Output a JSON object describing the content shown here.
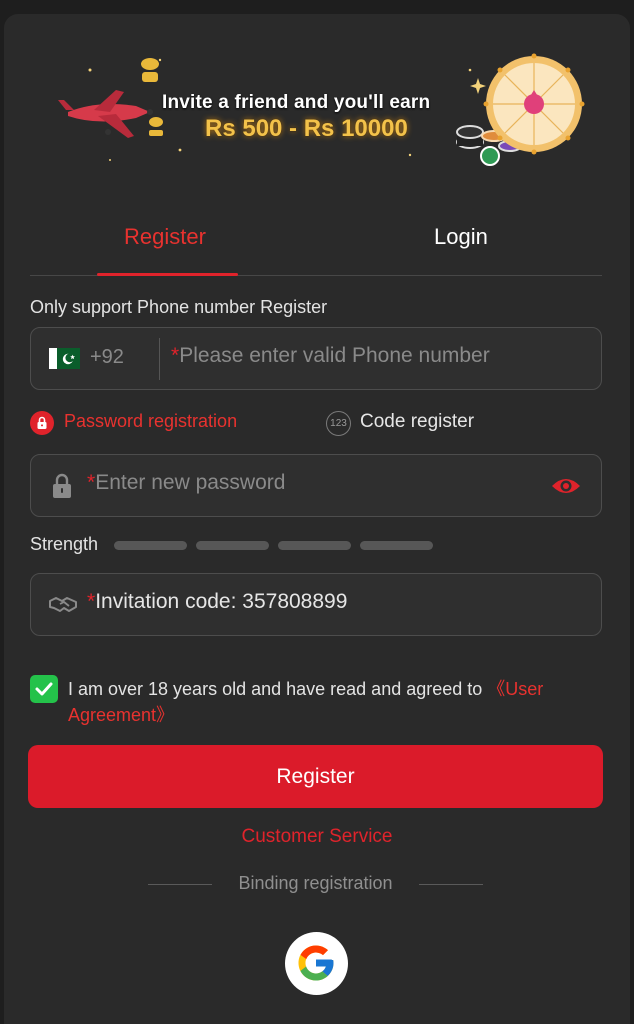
{
  "banner": {
    "title": "Invite a friend and you'll earn",
    "amount": "Rs 500 - Rs 10000"
  },
  "tabs": [
    {
      "label": "Register",
      "active": true
    },
    {
      "label": "Login",
      "active": false
    }
  ],
  "register_form": {
    "phone_label": "Only support Phone number Register",
    "country_code": "+92",
    "country_flag": "pakistan-flag-icon",
    "phone_placeholder": "Please enter valid Phone number",
    "required_mark": "*",
    "methods": [
      {
        "label": "Password registration",
        "icon": "lock-icon",
        "selected": true
      },
      {
        "label": "Code register",
        "icon": "123-icon",
        "icon_text": "123",
        "selected": false
      }
    ],
    "password_placeholder": "Enter new password",
    "strength_label": "Strength",
    "strength_level": 0,
    "strength_segments": 4,
    "invite_value": "Invitation code: 357808899",
    "agreement_checked": true,
    "agreement_text": "I am over 18 years old and have read and agreed to ",
    "agreement_link": "《User Agreement》",
    "submit_label": "Register"
  },
  "footer": {
    "customer_service": "Customer Service",
    "binding_label": "Binding registration",
    "social": [
      {
        "name": "google-icon"
      }
    ]
  },
  "colors": {
    "accent": "#e0232b",
    "background": "#2a2a2a",
    "checkbox": "#24c24a"
  }
}
